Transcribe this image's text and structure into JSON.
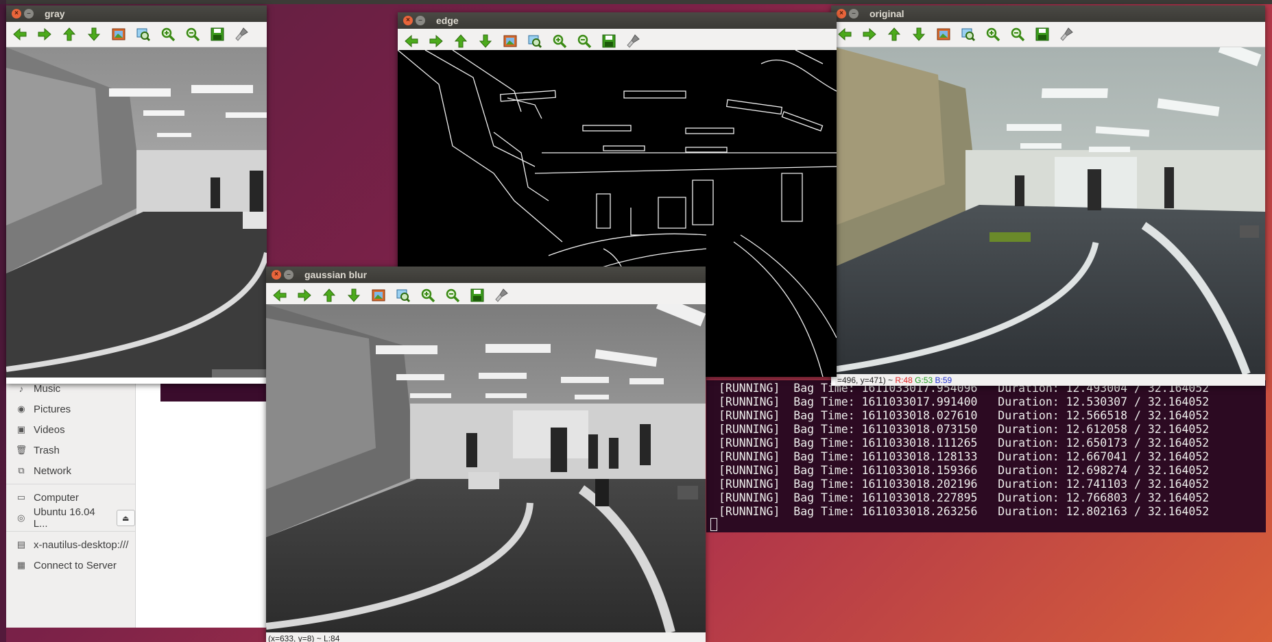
{
  "colors": {
    "titlebar": "#3b3a36",
    "toolbar": "#f2f1f0",
    "terminal_bg": "#2c0a22",
    "accent_close": "#e9653b",
    "r": "#e02020",
    "g": "#1a9a1a",
    "b": "#2030d0"
  },
  "toolbar_icons": [
    "arrow-left-icon",
    "arrow-right-icon",
    "arrow-up-icon",
    "arrow-down-icon",
    "image-icon",
    "zoom-fit-icon",
    "zoom-in-icon",
    "zoom-out-icon",
    "save-icon",
    "brush-icon"
  ],
  "windows": {
    "gray": {
      "title": "gray"
    },
    "edge": {
      "title": "edge"
    },
    "original": {
      "title": "original",
      "status_coords": "=496, y=471) ~ ",
      "r": "R:48",
      "g": "G:53",
      "b": "B:59"
    },
    "gaussian": {
      "title": "gaussian blur",
      "status": "(x=633, y=8) ~ L:84"
    }
  },
  "nautilus": {
    "items": [
      {
        "label": "Music",
        "icon": "music-icon",
        "glyph": "♪"
      },
      {
        "label": "Pictures",
        "icon": "camera-icon",
        "glyph": "◉"
      },
      {
        "label": "Videos",
        "icon": "video-icon",
        "glyph": "▣"
      },
      {
        "label": "Trash",
        "icon": "trash-icon",
        "glyph": "🗑"
      },
      {
        "label": "Network",
        "icon": "network-icon",
        "glyph": "⧉"
      }
    ],
    "devices": [
      {
        "label": "Computer",
        "icon": "computer-icon",
        "glyph": "▭"
      },
      {
        "label": "Ubuntu 16.04 L...",
        "icon": "disc-icon",
        "glyph": "◎"
      }
    ],
    "bookmarks": [
      {
        "label": "x-nautilus-desktop:///",
        "icon": "desktop-icon",
        "glyph": "▤"
      },
      {
        "label": "Connect to Server",
        "icon": "server-icon",
        "glyph": "▦"
      }
    ]
  },
  "terminal": {
    "lines": [
      "[RUNNING]  Bag Time: 1611033017.954096   Duration: 12.493004 / 32.164052",
      "[RUNNING]  Bag Time: 1611033017.991400   Duration: 12.530307 / 32.164052",
      "[RUNNING]  Bag Time: 1611033018.027610   Duration: 12.566518 / 32.164052",
      "[RUNNING]  Bag Time: 1611033018.073150   Duration: 12.612058 / 32.164052",
      "[RUNNING]  Bag Time: 1611033018.111265   Duration: 12.650173 / 32.164052",
      "[RUNNING]  Bag Time: 1611033018.128133   Duration: 12.667041 / 32.164052",
      "[RUNNING]  Bag Time: 1611033018.159366   Duration: 12.698274 / 32.164052",
      "[RUNNING]  Bag Time: 1611033018.202196   Duration: 12.741103 / 32.164052",
      "[RUNNING]  Bag Time: 1611033018.227895   Duration: 12.766803 / 32.164052",
      "[RUNNING]  Bag Time: 1611033018.263256   Duration: 12.802163 / 32.164052"
    ]
  }
}
